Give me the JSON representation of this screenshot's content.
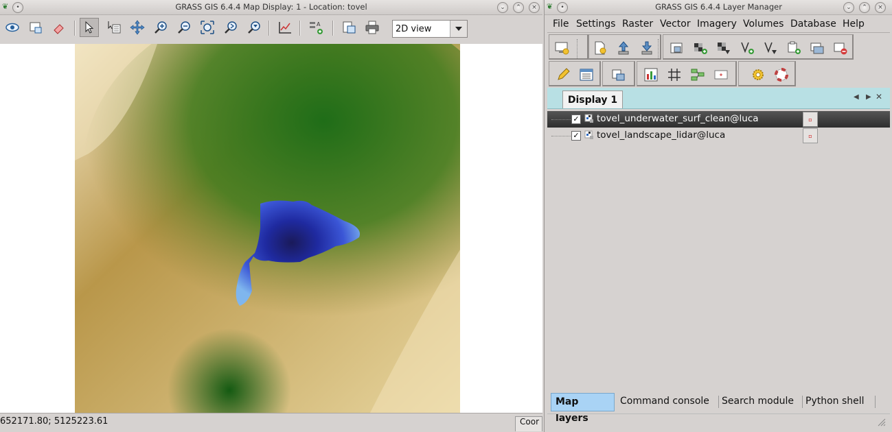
{
  "map_window": {
    "title": "GRASS GIS 6.4.4 Map Display: 1  - Location: tovel",
    "view_mode": "2D view",
    "status_coords": "652171.80; 5125223.61",
    "status_button": "Coor",
    "toolbar_icons": [
      "display-eye-icon",
      "render-map-icon",
      "erase-icon",
      "pointer-icon",
      "query-icon",
      "pan-icon",
      "zoom-in-icon",
      "zoom-out-icon",
      "zoom-extent-icon",
      "zoom-back-icon",
      "zoom-menu-icon",
      "analyze-icon",
      "overlay-add-icon",
      "save-image-icon",
      "print-icon"
    ]
  },
  "layer_manager": {
    "title": "GRASS GIS 6.4.4 Layer Manager",
    "menus": [
      "File",
      "Settings",
      "Raster",
      "Vector",
      "Imagery",
      "Volumes",
      "Database",
      "Help"
    ],
    "display_tab": "Display 1",
    "layers": [
      {
        "name": "tovel_underwater_surf_clean@luca",
        "checked": true,
        "selected": true
      },
      {
        "name": "tovel_landscape_lidar@luca",
        "checked": true,
        "selected": false
      }
    ],
    "bottom_tabs": [
      "Map layers",
      "Command console",
      "Search module",
      "Python shell"
    ],
    "active_tab": "Map layers"
  },
  "colors": {
    "window_bg": "#d6d2d0",
    "notebook_bg": "#b8e0e4",
    "selected_row": "#3c3c3c",
    "active_tab": "#a9d3f5"
  }
}
